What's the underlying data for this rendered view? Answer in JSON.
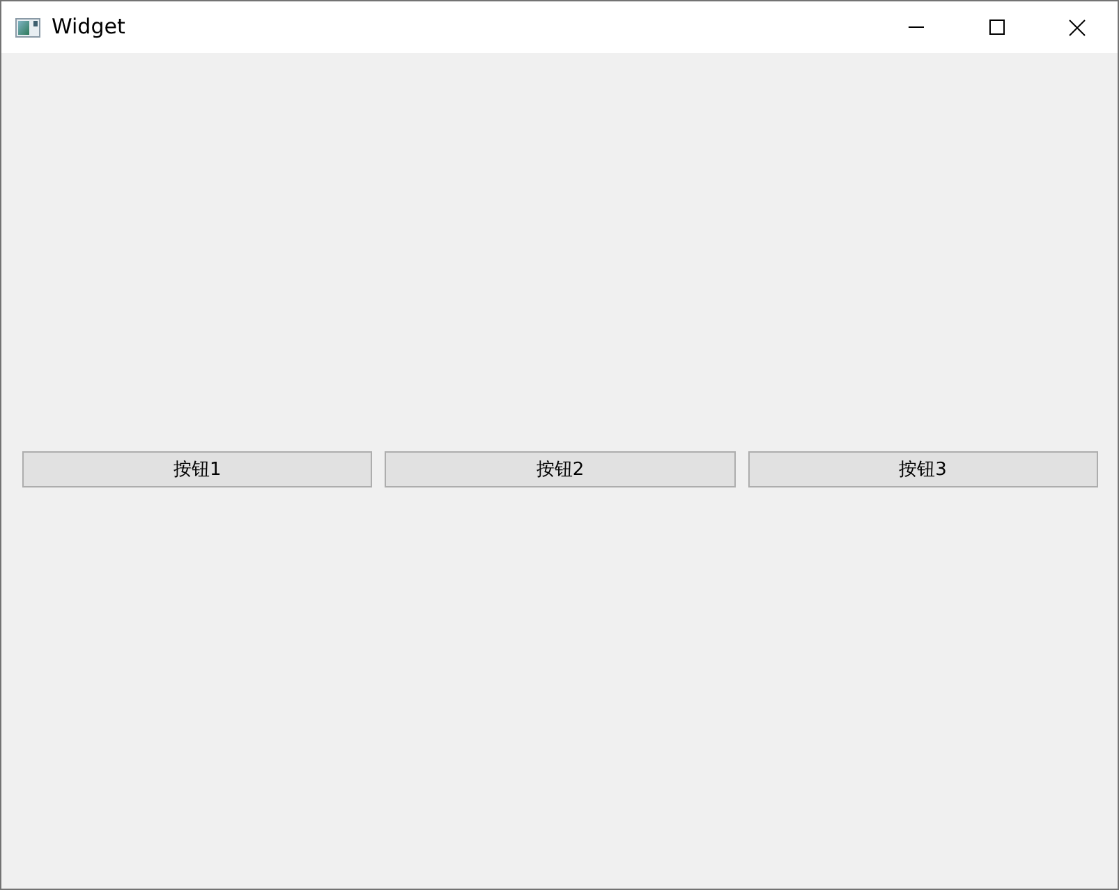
{
  "window": {
    "title": "Widget"
  },
  "buttons": [
    "按钮1",
    "按钮2",
    "按钮3"
  ]
}
